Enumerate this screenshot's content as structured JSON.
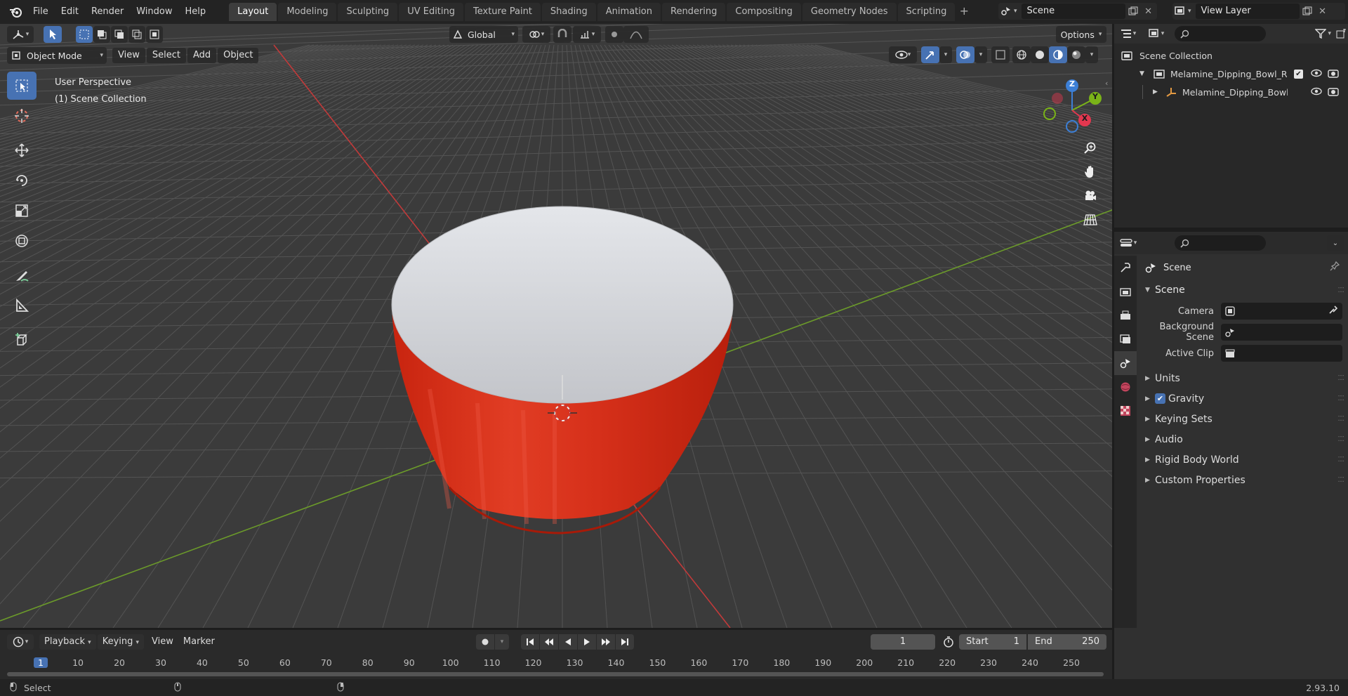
{
  "menu": [
    "File",
    "Edit",
    "Render",
    "Window",
    "Help"
  ],
  "workspaces": [
    "Layout",
    "Modeling",
    "Sculpting",
    "UV Editing",
    "Texture Paint",
    "Shading",
    "Animation",
    "Rendering",
    "Compositing",
    "Geometry Nodes",
    "Scripting"
  ],
  "active_workspace": "Layout",
  "scene_name": "Scene",
  "view_layer": "View Layer",
  "viewport": {
    "mode": "Object Mode",
    "menus": [
      "View",
      "Select",
      "Add",
      "Object"
    ],
    "transform_orientation": "Global",
    "options_label": "Options",
    "info_line1": "User Perspective",
    "info_line2": "(1) Scene Collection",
    "gizmo": {
      "z": "Z",
      "y": "Y",
      "x": "X"
    }
  },
  "outliner": {
    "root": "Scene Collection",
    "collection": "Melamine_Dipping_Bowl_Rou",
    "object": "Melamine_Dipping_Bowl_"
  },
  "properties": {
    "context_title": "Scene",
    "panel": "Scene",
    "rows": [
      {
        "label": "Camera"
      },
      {
        "label": "Background Scene"
      },
      {
        "label": "Active Clip"
      }
    ],
    "subpanels": [
      "Units",
      "Gravity",
      "Keying Sets",
      "Audio",
      "Rigid Body World",
      "Custom Properties"
    ],
    "gravity_checked": true
  },
  "timeline": {
    "menus": [
      "Playback",
      "Keying",
      "View",
      "Marker"
    ],
    "current_frame": "1",
    "start_label": "Start",
    "start_value": "1",
    "end_label": "End",
    "end_value": "250",
    "ruler": [
      "1",
      "10",
      "20",
      "30",
      "40",
      "50",
      "60",
      "70",
      "80",
      "90",
      "100",
      "110",
      "120",
      "130",
      "140",
      "150",
      "160",
      "170",
      "180",
      "190",
      "200",
      "210",
      "220",
      "230",
      "240",
      "250"
    ]
  },
  "status": {
    "left": "Select",
    "version": "2.93.10"
  },
  "colors": {
    "accent": "#4772b3",
    "bowl_red": "#d9301c",
    "x_axis": "#c23a3a",
    "y_axis": "#6b9a2a"
  }
}
